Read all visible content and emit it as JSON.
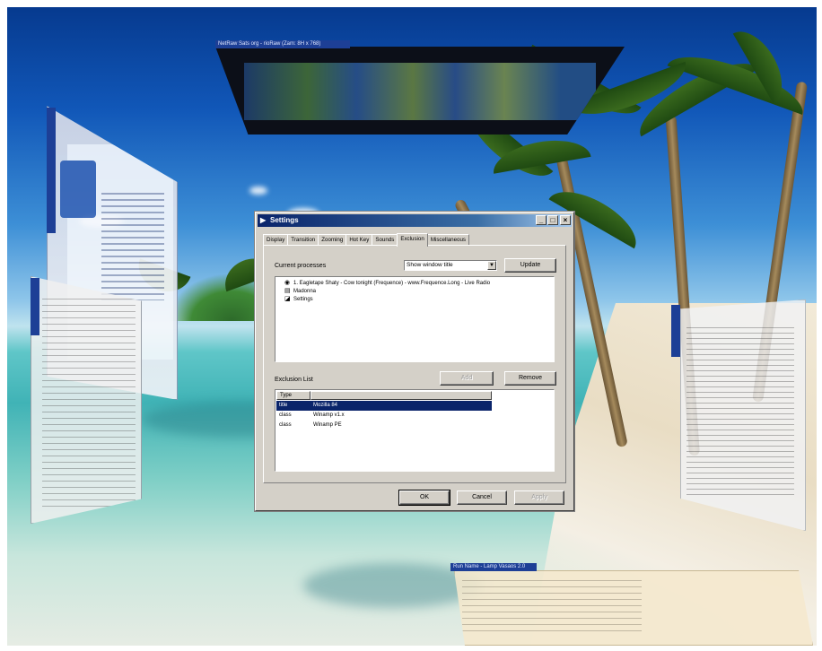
{
  "colors": {
    "title_bar": "#0a246a",
    "selection": "#0a246a",
    "dialog_face": "#d4d0c8",
    "floating_title": "#1d3f96"
  },
  "background_windows": {
    "map_title": "NetRaw Sats org - rioRaw (Zam: 8H x 768)",
    "bottom_title": "Run Name - Lamp Vasaos 2.0",
    "left_title": "",
    "right_title": ""
  },
  "dialog": {
    "title": "Settings",
    "title_icon": "arrow-icon",
    "minimize": "_",
    "maximize": "□",
    "close": "×",
    "tabs": [
      {
        "label": "Display",
        "active": false
      },
      {
        "label": "Transition",
        "active": false
      },
      {
        "label": "Zooming",
        "active": false
      },
      {
        "label": "Hot Key",
        "active": false
      },
      {
        "label": "Sounds",
        "active": false
      },
      {
        "label": "Exclusion",
        "active": true
      },
      {
        "label": "Miscellaneous",
        "active": false
      }
    ],
    "current_processes_label": "Current processes",
    "combo_value": "Show window title",
    "combo_arrow": "▼",
    "update_button": "Update",
    "processes": [
      {
        "icon": "winamp-icon",
        "glyph": "◉",
        "label": "1. Eagletape Shaty - Cow tonight (Frequence) - www.Frequence.Long - Live Radio"
      },
      {
        "icon": "monitor-icon",
        "glyph": "▤",
        "label": "Madonna"
      },
      {
        "icon": "settings-icon",
        "glyph": "◪",
        "label": "Settings"
      }
    ],
    "exclusion_list_label": "Exclusion List",
    "add_button": "Add",
    "remove_button": "Remove",
    "exclusion_columns": [
      "Type",
      ""
    ],
    "exclusions": [
      {
        "type": "title",
        "name": "Mozilla 84",
        "selected": true
      },
      {
        "type": "class",
        "name": "Winamp v1.x",
        "selected": false
      },
      {
        "type": "class",
        "name": "Winamp PE",
        "selected": false
      }
    ],
    "ok_button": "OK",
    "cancel_button": "Cancel",
    "apply_button": "Apply"
  }
}
